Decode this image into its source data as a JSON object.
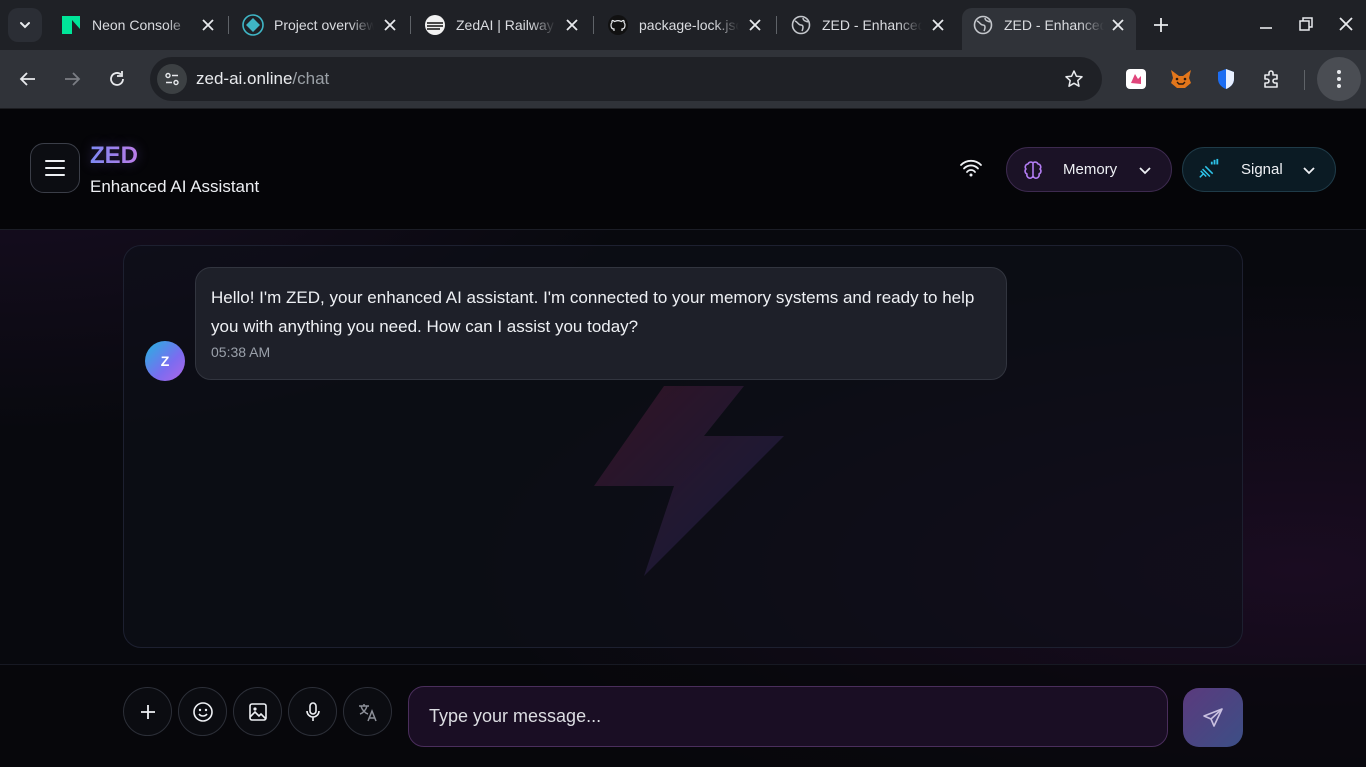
{
  "browser": {
    "tabs": [
      {
        "title": "Neon Console",
        "icon": "neon-logo-icon"
      },
      {
        "title": "Project overview",
        "icon": "project-diamond-icon"
      },
      {
        "title": "ZedAI | Railway",
        "icon": "railway-logo-icon"
      },
      {
        "title": "package-lock.json",
        "icon": "github-logo-icon"
      },
      {
        "title": "ZED - Enhanced AI Assistant",
        "icon": "globe-icon"
      },
      {
        "title": "ZED - Enhanced AI Assistant",
        "icon": "globe-icon",
        "active": true
      }
    ],
    "url_host": "zed-ai.online",
    "url_path": "/chat",
    "extensions": [
      "kite-extension-icon",
      "metamask-fox-icon",
      "shield-extension-icon",
      "puzzle-extensions-icon"
    ]
  },
  "header": {
    "brand": "ZED",
    "subtitle": "Enhanced AI Assistant",
    "memory_label": "Memory",
    "signal_label": "Signal"
  },
  "chat": {
    "messages": [
      {
        "sender_initial": "Z",
        "text": "Hello! I'm ZED, your enhanced AI assistant. I'm connected to your memory systems and ready to help you with anything you need. How can I assist you today?",
        "time": "05:38 AM"
      }
    ]
  },
  "composer": {
    "placeholder": "Type your message...",
    "tools": [
      "plus-icon",
      "emoji-icon",
      "image-icon",
      "microphone-icon",
      "translate-icon"
    ]
  },
  "colors": {
    "accent_purple": "#a66cff",
    "accent_cyan": "#22c5e8",
    "background": "#08090e"
  }
}
